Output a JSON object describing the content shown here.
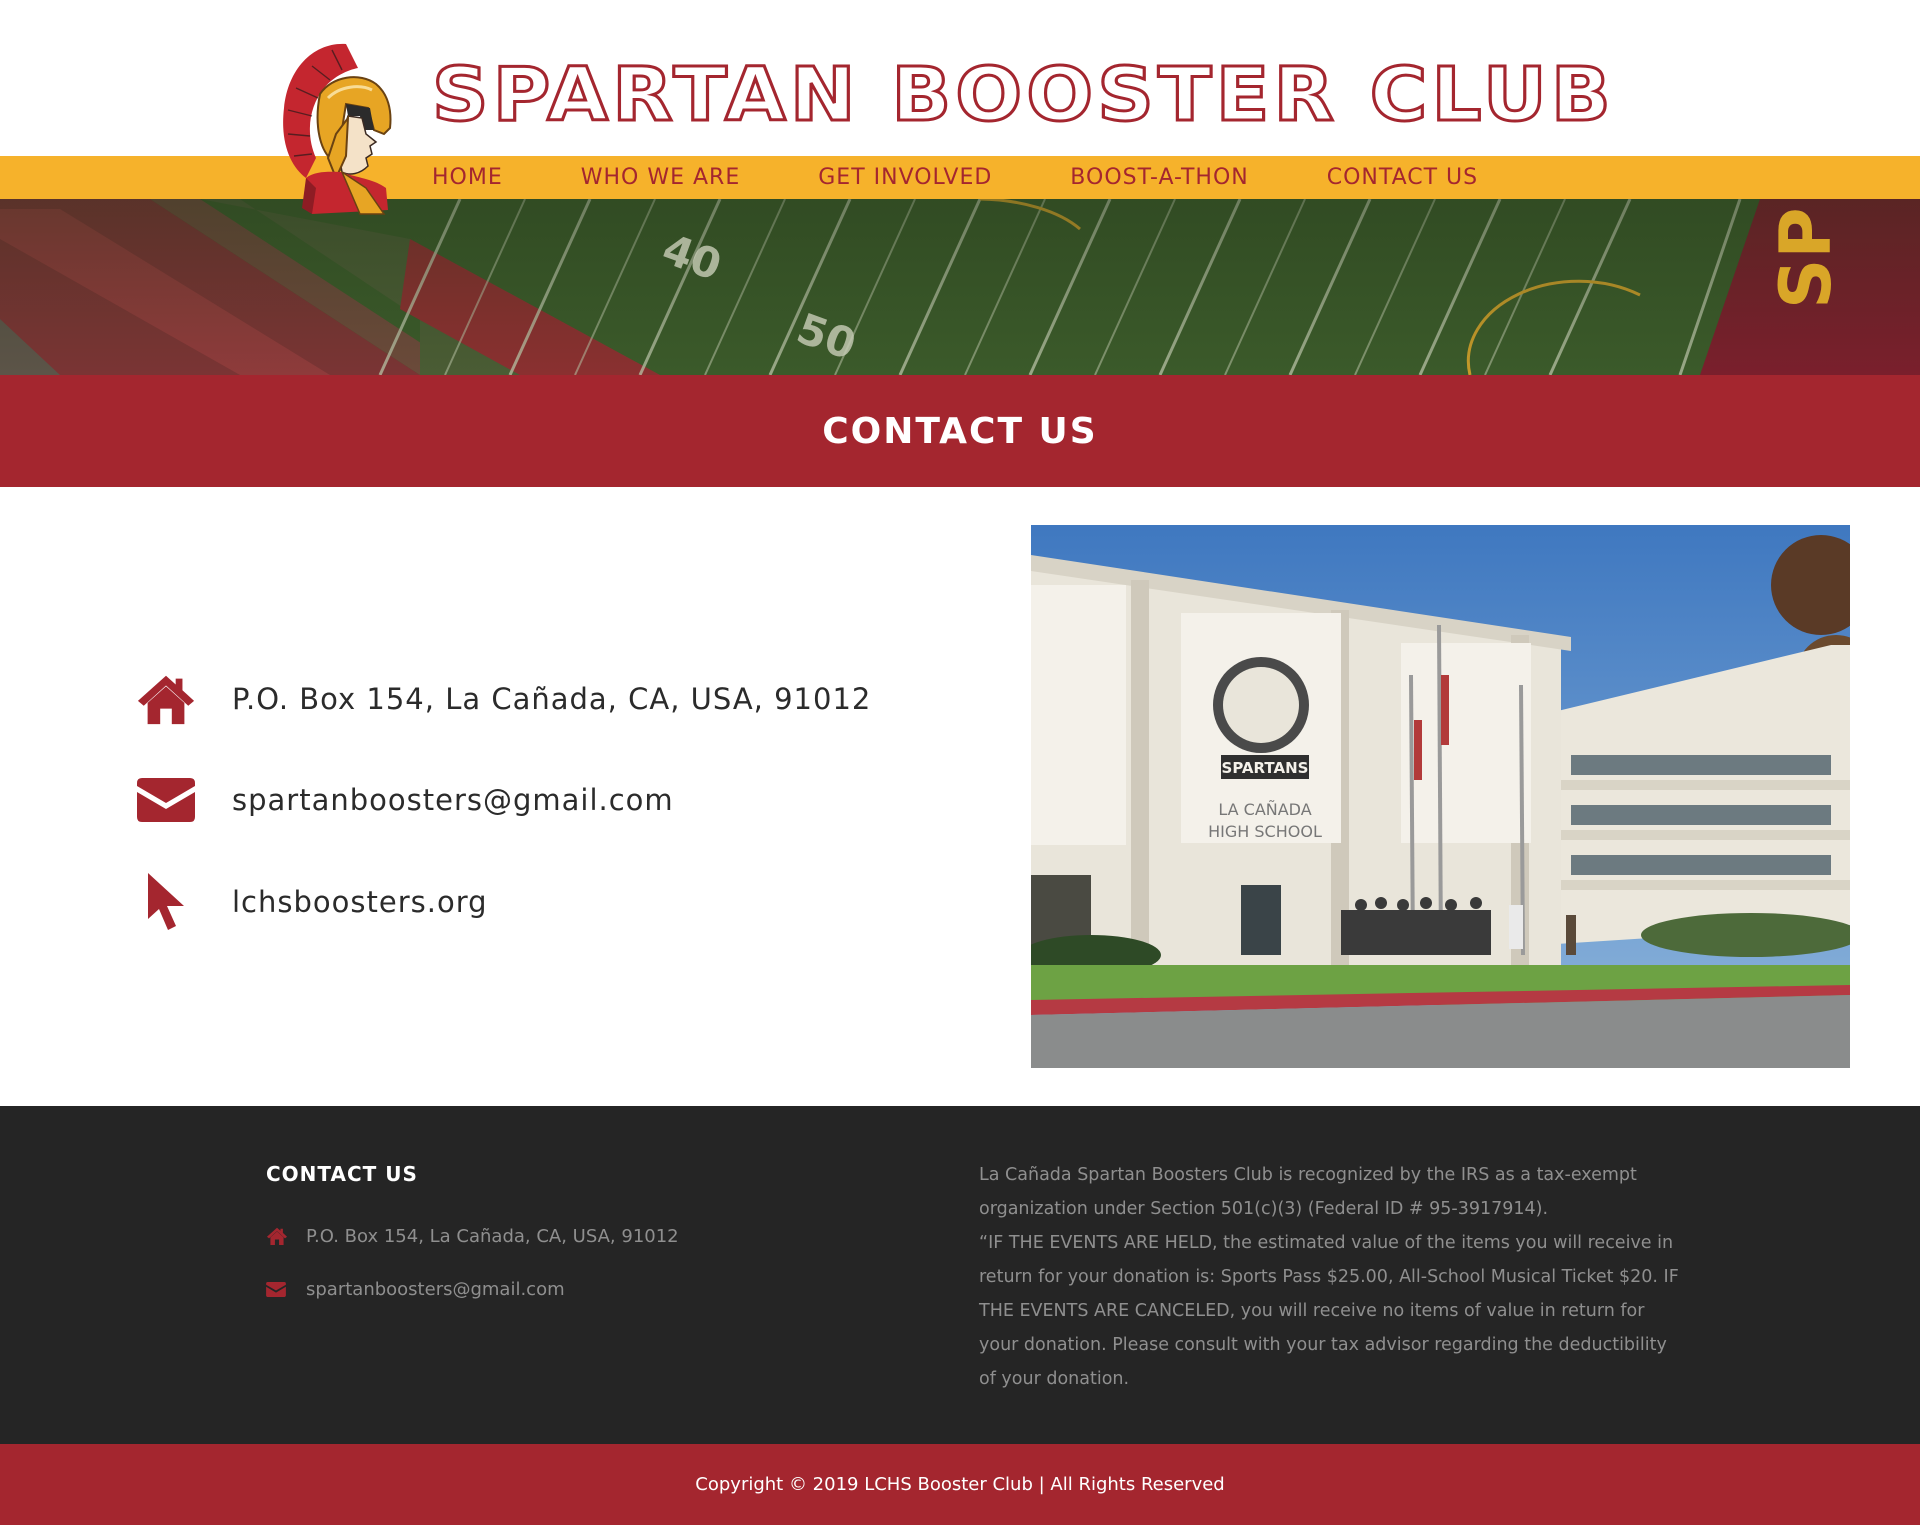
{
  "site": {
    "title": "SPARTAN BOOSTER CLUB",
    "logo_icon": "spartan-helmet-logo"
  },
  "nav": {
    "items": [
      {
        "label": "HOME"
      },
      {
        "label": "WHO WE ARE"
      },
      {
        "label": "GET INVOLVED"
      },
      {
        "label": "BOOST-A-THON"
      },
      {
        "label": "CONTACT US"
      }
    ]
  },
  "hero": {
    "yard_numbers": [
      "40",
      "50"
    ],
    "endzone_text": "SP"
  },
  "page": {
    "title": "CONTACT US"
  },
  "contact": {
    "address": {
      "text": "P.O. Box 154, La Cañada, CA, USA, 91012",
      "icon": "home-icon"
    },
    "email": {
      "text": "spartanboosters@gmail.com",
      "icon": "envelope-icon"
    },
    "website": {
      "text": "lchsboosters.org",
      "icon": "pointer-icon"
    }
  },
  "photo": {
    "banner_text": "SPARTANS",
    "wall_text_line1": "LA CAÑADA",
    "wall_text_line2": "HIGH SCHOOL"
  },
  "footer": {
    "heading": "CONTACT US",
    "address": "P.O. Box 154, La Cañada, CA, USA, 91012",
    "email": "spartanboosters@gmail.com",
    "tax_note_1": "La Cañada Spartan Boosters Club is recognized by the IRS as a tax-exempt organization under Section 501(c)(3) (Federal ID # 95-3917914).",
    "tax_note_2": "“IF THE EVENTS ARE HELD, the estimated value of the items you will receive in return for your donation is: Sports Pass $25.00, All-School Musical Ticket $20.  IF THE EVENTS ARE CANCELED, you will receive no items of value in return for your donation.  Please consult with your tax advisor regarding the deductibility of your donation."
  },
  "copyright": "Copyright © 2019 LCHS Booster Club | All Rights Reserved",
  "colors": {
    "brand_red": "#a4262f",
    "brand_gold": "#f6b22b",
    "footer_bg": "#252525",
    "footer_text": "#8f8f8f"
  }
}
